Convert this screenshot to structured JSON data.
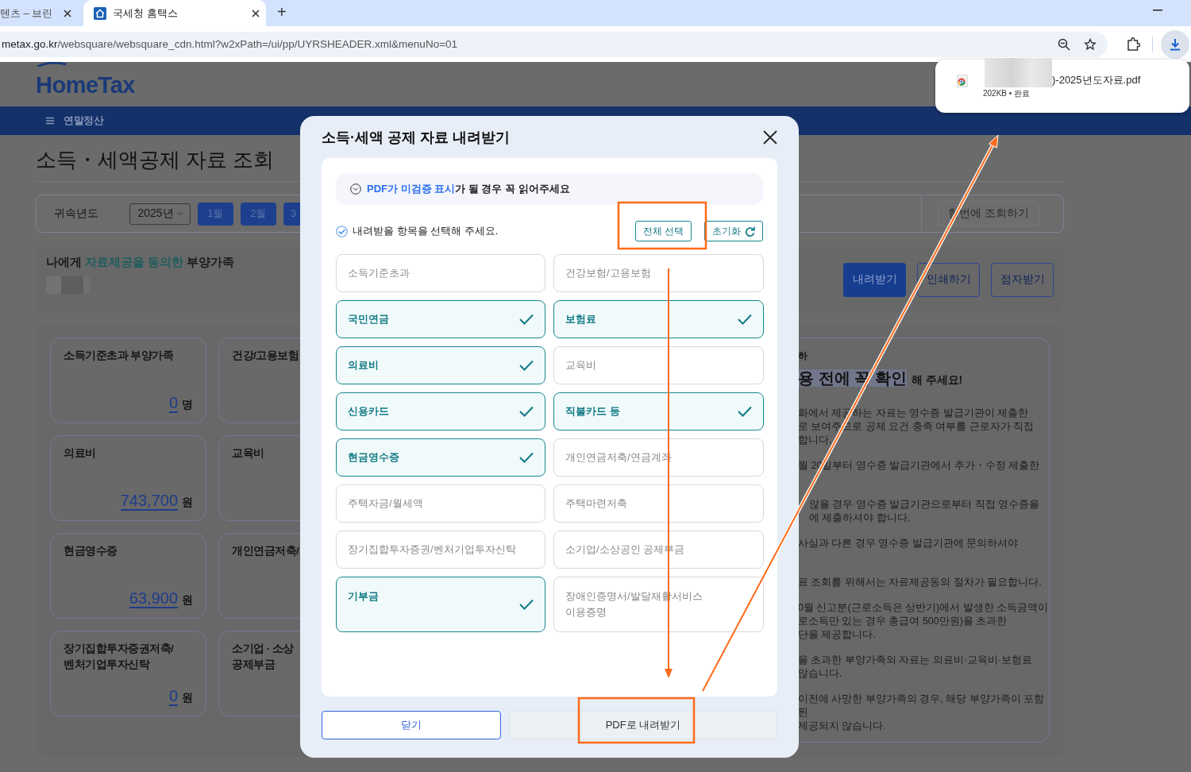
{
  "browser": {
    "tabs": [
      {
        "title": "텐츠 – 브린",
        "selected": false
      },
      {
        "title": "국세청 홈택스",
        "selected": true
      }
    ],
    "new_tab": "+",
    "address": {
      "domain": "metax.go.kr",
      "path": "/websquare/websquare_cdn.html?w2xPath=/ui/pp/UYRSHEADER.xml&menuNo=01"
    }
  },
  "download_popup": {
    "file_name": ")-2025년도자료.pdf",
    "status": "202KB • 완료"
  },
  "page": {
    "logo": "HomeTax",
    "menu": "연말정산",
    "title": "소득・세액공제 자료 조회",
    "filter": {
      "label": "귀속년도",
      "year": "2025년",
      "months": [
        "1월",
        "2월",
        "3"
      ],
      "query_all": "한번에 조회하기"
    },
    "family": {
      "before": "나에게",
      "highlight": "자료제공을 동의한",
      "after": "부양가족"
    },
    "actions": [
      {
        "label": "내려받기",
        "kind": "primary"
      },
      {
        "label": "인쇄하기",
        "kind": "outline"
      },
      {
        "label": "점자받기",
        "kind": "outline"
      }
    ],
    "cards": [
      {
        "title": "소득기준초과 부양가족",
        "amount": "0",
        "unit": "명"
      },
      {
        "title": "건강/고용보험"
      },
      {
        "title": "의료비",
        "amount": "743,700",
        "unit": "원"
      },
      {
        "title": "교육비"
      },
      {
        "title": "현금영수증",
        "amount": "63,900",
        "unit": "원"
      },
      {
        "title": "개인연금저축/"
      },
      {
        "title": "장기집합투자증권저축/\n벤처기업투자신탁",
        "amount": "0",
        "unit": "원"
      },
      {
        "title": "소기업 · 소상\n공제부금"
      }
    ],
    "notice": {
      "kicker": "하",
      "emphasis": "용 전에 꼭 확인",
      "rest": "해 주세요!",
      "paragraphs": [
        "화에서 제공하는 자료는 영수증 발급기관이 제출한\n로 보여주므로 공제 요건 충족 여부를 근로자가 직접\n합니다.",
        "월 20일부터 영수증 발급기관에서 추가・수정 제출한",
        "않을 경우 영수증 발급기관으로부터 직접 영수증을\n에 제출하셔야 합니다.",
        "사실과 다른 경우 영수증 발급기관에 문의하셔야",
        "료 조회를 위해서는 자료제공동의 절차가 필요합니다.",
        "0월 신고분(근로소득은 상반기)에서 발생한 소득금액이\n로소득만 있는 경우 총급여 500만원)을 초과한\n단을 제공합니다.",
        "을 초과한 부양가족의 자료는 의료비·교육비·보험료\n않습니다.",
        "이전에 사망한 부양가족의 경우, 해당 부양가족이 포함된\n제공되지 않습니다."
      ]
    }
  },
  "dialog": {
    "title": "소득·세액 공제 자료 내려받기",
    "notice": {
      "highlight": "PDF가 미검증 표시",
      "text": "가 될 경우 꼭 읽어주세요"
    },
    "instruction": "내려받을 항목을 선택해 주세요.",
    "select_all": "전체 선택",
    "reset": "초기화",
    "items": [
      {
        "label": "소득기준초과",
        "selected": false
      },
      {
        "label": "건강보험/고용보험",
        "selected": false
      },
      {
        "label": "국민연금",
        "selected": true
      },
      {
        "label": "보험료",
        "selected": true
      },
      {
        "label": "의료비",
        "selected": true
      },
      {
        "label": "교육비",
        "selected": false
      },
      {
        "label": "신용카드",
        "selected": true
      },
      {
        "label": "직불카드 등",
        "selected": true
      },
      {
        "label": "현금영수증",
        "selected": true
      },
      {
        "label": "개인연금저축/연금계좌",
        "selected": false
      },
      {
        "label": "주택자금/월세액",
        "selected": false
      },
      {
        "label": "주택마련저축",
        "selected": false
      },
      {
        "label": "장기집합투자증권/벤처기업투자신탁",
        "selected": false
      },
      {
        "label": "소기업/소상공인 공제부금",
        "selected": false
      },
      {
        "label": "기부금",
        "selected": true
      },
      {
        "label": "장애인증명서/발달재활서비스\n이용증명",
        "selected": false
      }
    ],
    "buttons": [
      {
        "label": "닫기",
        "disabled": false
      },
      {
        "label": "PDF로 내려받기",
        "disabled": true
      }
    ]
  }
}
